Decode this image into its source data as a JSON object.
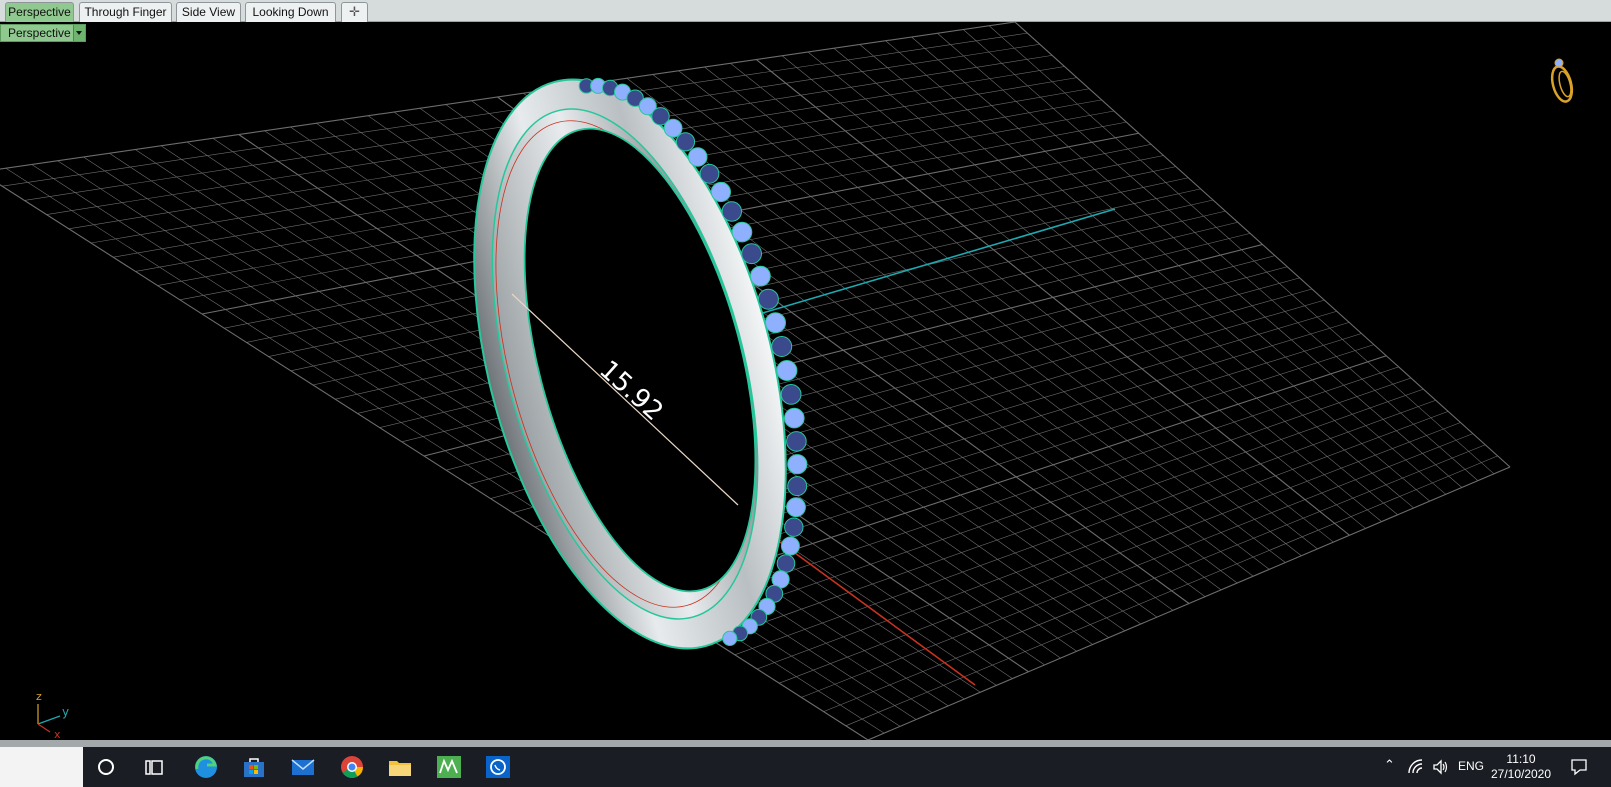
{
  "tabs": [
    {
      "label": "Perspective",
      "active": true
    },
    {
      "label": "Through Finger",
      "active": false
    },
    {
      "label": "Side View",
      "active": false
    },
    {
      "label": "Looking Down",
      "active": false
    }
  ],
  "add_tab_icon": "plus-icon",
  "viewport": {
    "view_name": "Perspective",
    "dimension_value": "15.92",
    "axis_labels": {
      "z": "z",
      "y": "y",
      "x": "x"
    },
    "colors": {
      "grid": "#6d6d6d",
      "y_axis": "#1ea8b0",
      "x_axis": "#c8321e",
      "metal": "#cfd3d6",
      "gem": "#8fb0ff",
      "outline": "#27c79c"
    }
  },
  "taskbar": {
    "icons": [
      "search-circle-icon",
      "task-view-icon",
      "edge-icon",
      "store-icon",
      "mail-icon",
      "chrome-icon",
      "file-explorer-icon",
      "matrix-icon",
      "whatsapp-icon"
    ],
    "tray": {
      "language": "ENG",
      "time": "11:10",
      "date": "27/10/2020"
    }
  }
}
